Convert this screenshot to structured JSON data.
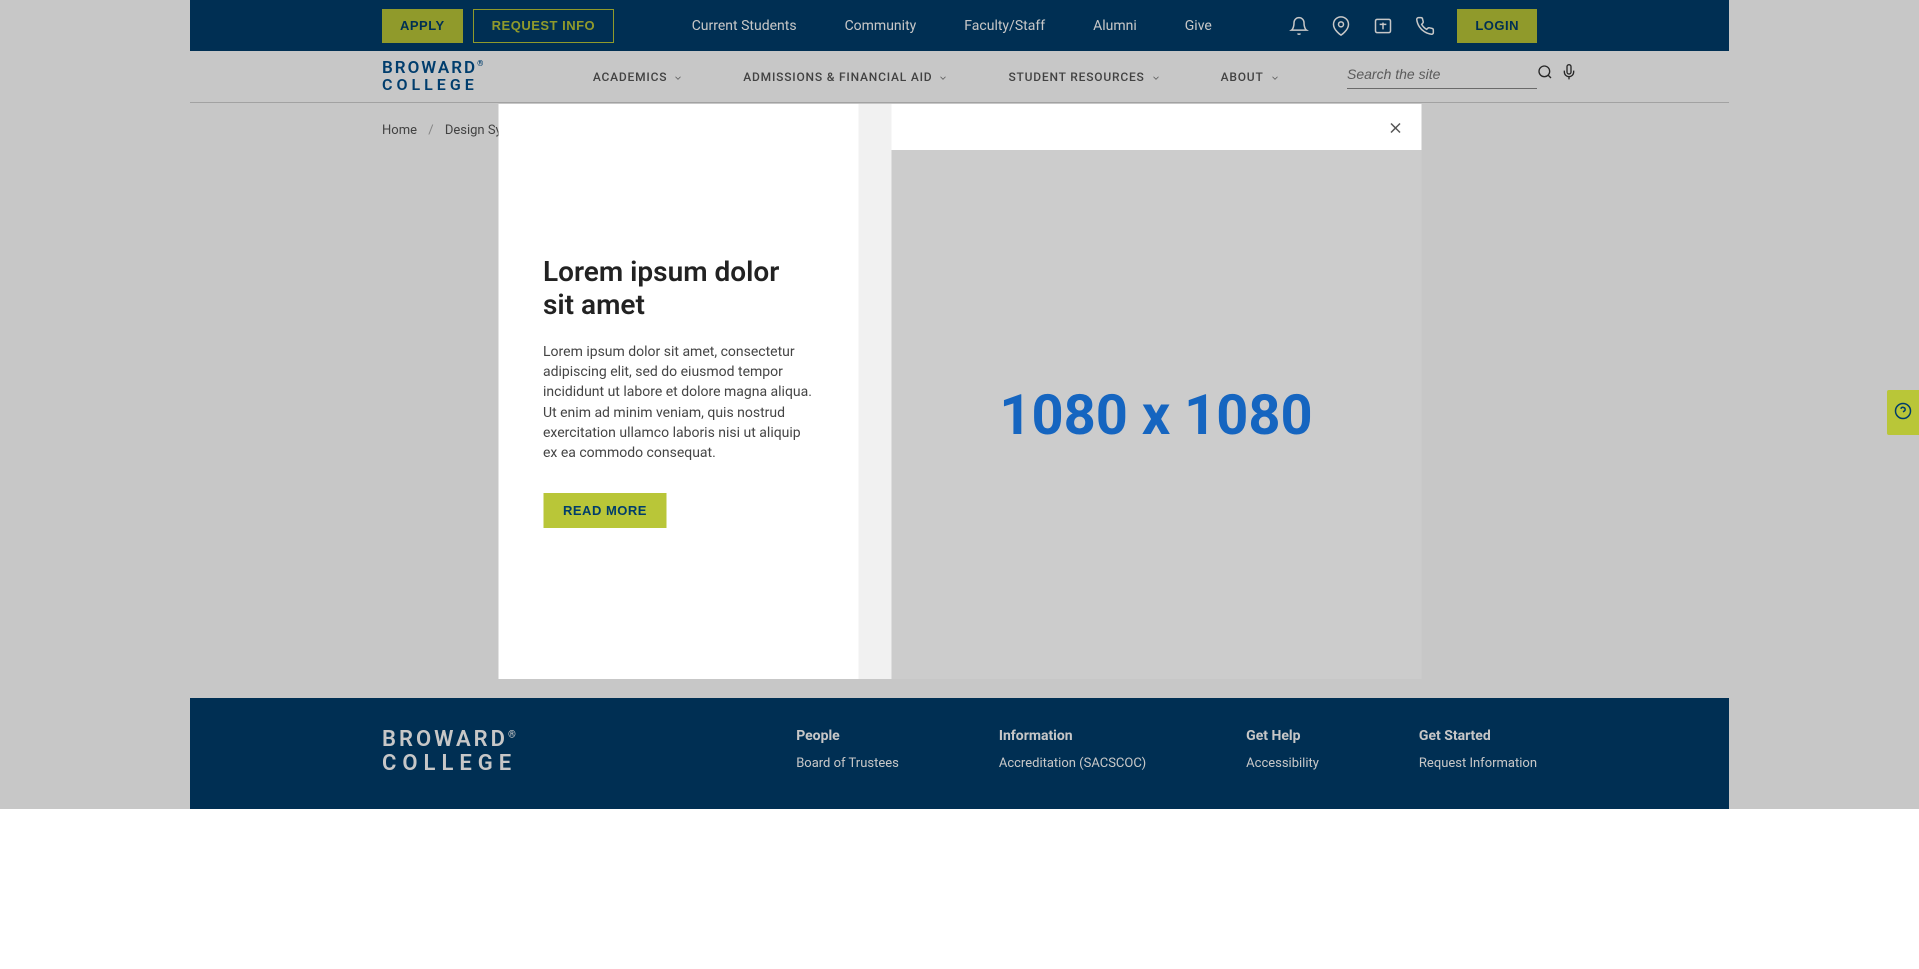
{
  "topbar": {
    "apply_label": "APPLY",
    "request_info_label": "REQUEST INFO",
    "login_label": "LOGIN",
    "links": {
      "current_students": "Current Students",
      "community": "Community",
      "faculty_staff": "Faculty/Staff",
      "alumni": "Alumni",
      "give": "Give"
    }
  },
  "logo": {
    "line1": "BROWARD",
    "line2": "COLLEGE"
  },
  "mainnav": {
    "academics": "ACADEMICS",
    "admissions": "ADMISSIONS & FINANCIAL AID",
    "resources": "STUDENT RESOURCES",
    "about": "ABOUT",
    "search_placeholder": "Search the site"
  },
  "breadcrumb": {
    "home": "Home",
    "current": "Design Sys"
  },
  "modal": {
    "title": "Lorem ipsum dolor sit amet",
    "body": "Lorem ipsum dolor sit amet, consectetur adipiscing elit, sed do eiusmod tempor incididunt ut labore et dolore magna aliqua. Ut enim ad minim veniam, quis nostrud exercitation ullamco laboris nisi ut aliquip ex ea commodo consequat.",
    "cta_label": "READ MORE",
    "image_placeholder": "1080 x 1080"
  },
  "footer": {
    "cols": {
      "people": {
        "heading": "People",
        "link1": "Board of Trustees"
      },
      "information": {
        "heading": "Information",
        "link1": "Accreditation (SACSCOC)"
      },
      "get_help": {
        "heading": "Get Help",
        "link1": "Accessibility"
      },
      "get_started": {
        "heading": "Get Started",
        "link1": "Request Information"
      }
    }
  }
}
